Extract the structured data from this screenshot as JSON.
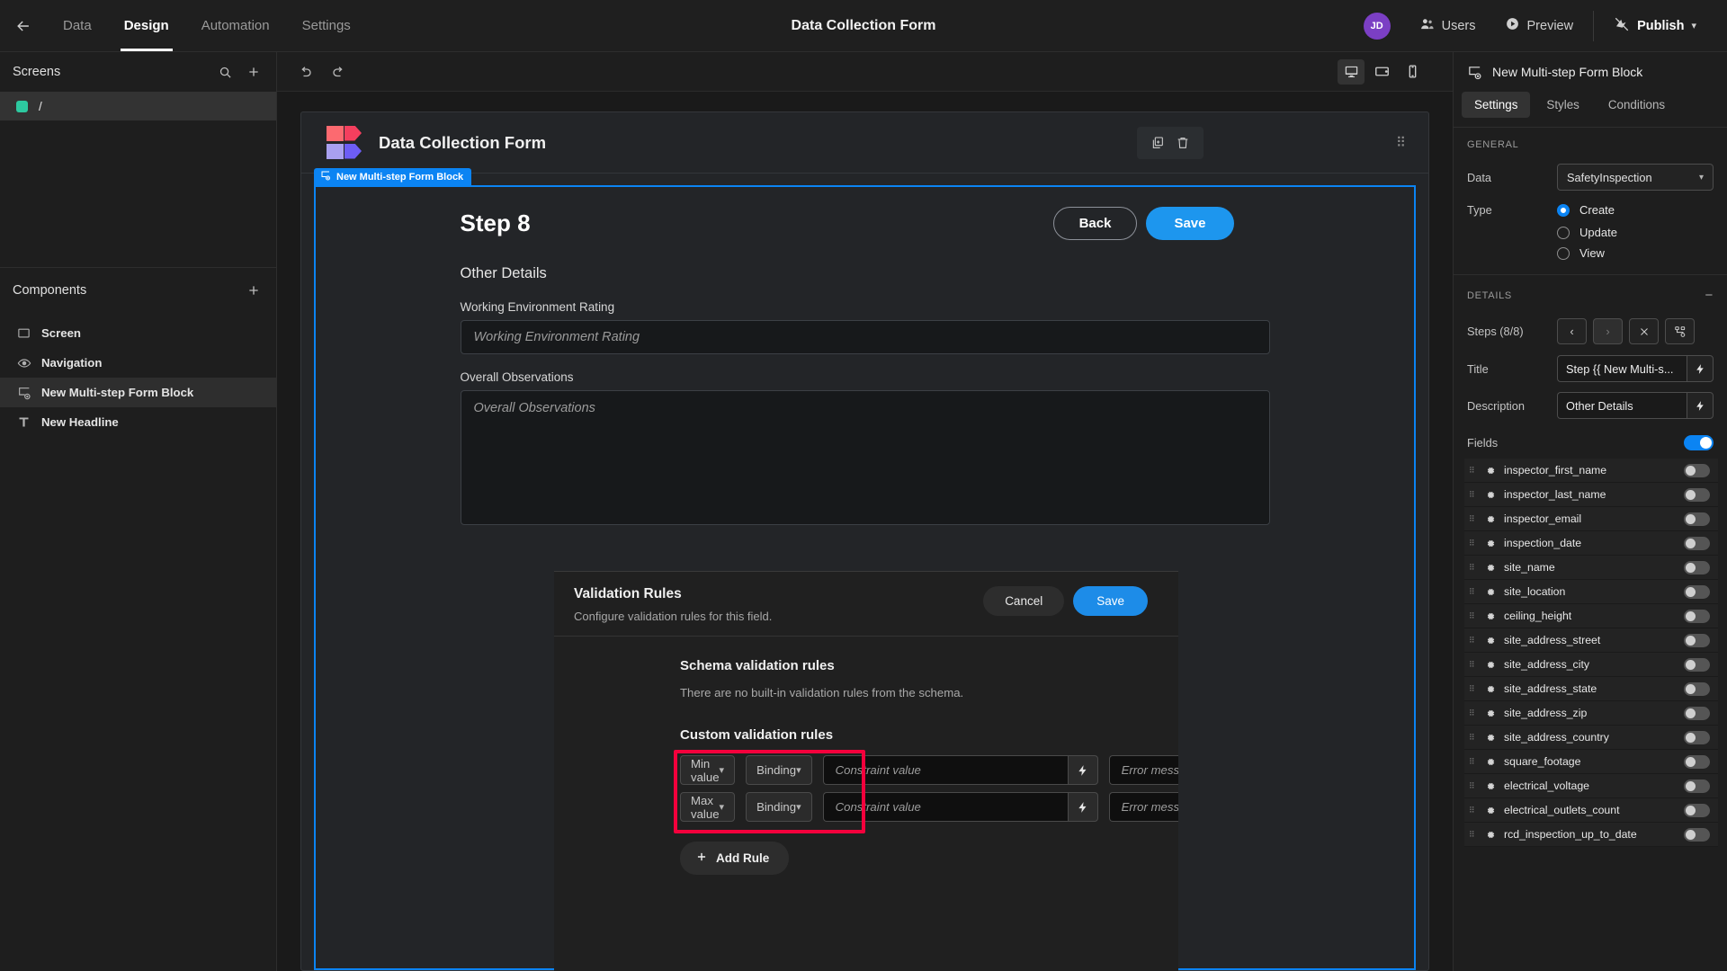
{
  "topbar": {
    "back_icon": "back-arrow-icon",
    "tabs": [
      {
        "label": "Data",
        "active": false
      },
      {
        "label": "Design",
        "active": true
      },
      {
        "label": "Automation",
        "active": false
      },
      {
        "label": "Settings",
        "active": false
      }
    ],
    "title": "Data Collection Form",
    "avatar_initials": "JD",
    "avatar_color": "#7b3fc4",
    "users_label": "Users",
    "preview_label": "Preview",
    "publish_label": "Publish"
  },
  "sidebar": {
    "screens": {
      "title": "Screens",
      "search_icon": "search-icon",
      "add_icon": "plus-icon",
      "items": [
        {
          "label": "/",
          "dot_color": "#2dc9a0",
          "selected": true
        }
      ]
    },
    "components": {
      "title": "Components",
      "add_icon": "plus-icon",
      "items": [
        {
          "label": "Screen",
          "icon": "screen-icon",
          "selected": false
        },
        {
          "label": "Navigation",
          "icon": "eye-icon",
          "selected": false
        },
        {
          "label": "New Multi-step Form Block",
          "icon": "form-block-icon",
          "selected": true
        },
        {
          "label": "New Headline",
          "icon": "text-icon",
          "selected": false
        }
      ]
    }
  },
  "canvas": {
    "toolbar": {
      "undo_icon": "undo-icon",
      "redo_icon": "redo-icon",
      "devices": [
        {
          "name": "desktop-icon",
          "active": true
        },
        {
          "name": "tablet-icon",
          "active": false
        },
        {
          "name": "mobile-icon",
          "active": false
        }
      ]
    },
    "form_header": {
      "title": "Data Collection Form",
      "copy_icon": "duplicate-icon",
      "delete_icon": "trash-icon",
      "grip_icon": "drag-handle-icon"
    },
    "block_tag": "New Multi-step Form Block",
    "step_title": "Step 8",
    "back_button": "Back",
    "save_button": "Save",
    "section_heading": "Other Details",
    "fields": [
      {
        "label": "Working Environment Rating",
        "placeholder": "Working Environment Rating",
        "type": "input"
      },
      {
        "label": "Overall Observations",
        "placeholder": "Overall Observations",
        "type": "textarea"
      }
    ]
  },
  "validation": {
    "title": "Validation Rules",
    "subtitle": "Configure validation rules for this field.",
    "cancel_label": "Cancel",
    "save_label": "Save",
    "schema_title": "Schema validation rules",
    "schema_note": "There are no built-in validation rules from the schema.",
    "custom_title": "Custom validation rules",
    "highlight_color": "#f5003c",
    "rules": [
      {
        "type": "Min value",
        "binding": "Binding",
        "constraint_placeholder": "Constraint value",
        "error_placeholder": "Error message",
        "bolt_icon": "lightning-icon",
        "copy_icon": "duplicate-icon",
        "remove_icon": "close-icon"
      },
      {
        "type": "Max value",
        "binding": "Binding",
        "constraint_placeholder": "Constraint value",
        "error_placeholder": "Error message",
        "bolt_icon": "lightning-icon",
        "copy_icon": "duplicate-icon",
        "remove_icon": "close-icon"
      }
    ],
    "add_rule_label": "Add Rule"
  },
  "rightpanel": {
    "header_title": "New Multi-step Form Block",
    "header_icon": "form-block-icon",
    "tabs": [
      {
        "label": "Settings",
        "active": true
      },
      {
        "label": "Styles",
        "active": false
      },
      {
        "label": "Conditions",
        "active": false
      }
    ],
    "general": {
      "section_title": "GENERAL",
      "data_label": "Data",
      "data_value": "SafetyInspection",
      "type_label": "Type",
      "type_options": [
        {
          "label": "Create",
          "selected": true
        },
        {
          "label": "Update",
          "selected": false
        },
        {
          "label": "View",
          "selected": false
        }
      ]
    },
    "details": {
      "section_title": "DETAILS",
      "collapse_icon": "minus-icon",
      "steps_label": "Steps (8/8)",
      "prev_icon": "chevron-left-icon",
      "next_icon": "chevron-right-icon",
      "close_icon": "close-icon",
      "flow_icon": "flow-icon",
      "title_label": "Title",
      "title_value": "Step {{ New Multi-s...",
      "description_label": "Description",
      "description_value": "Other Details",
      "fields_label": "Fields",
      "fields_toggle_on": true,
      "field_items": [
        "inspector_first_name",
        "inspector_last_name",
        "inspector_email",
        "inspection_date",
        "site_name",
        "site_location",
        "ceiling_height",
        "site_address_street",
        "site_address_city",
        "site_address_state",
        "site_address_zip",
        "site_address_country",
        "square_footage",
        "electrical_voltage",
        "electrical_outlets_count",
        "rcd_inspection_up_to_date"
      ]
    }
  }
}
